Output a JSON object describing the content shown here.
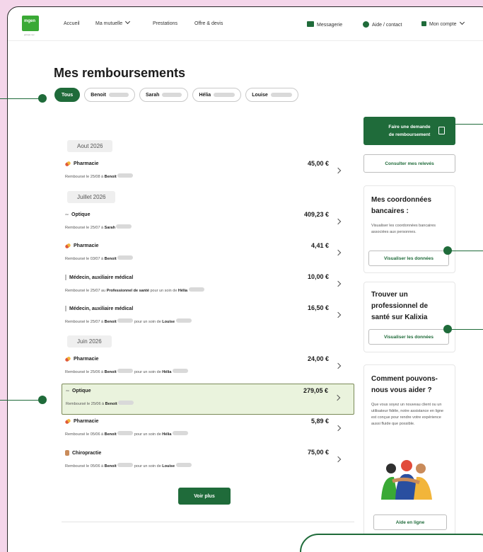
{
  "header": {
    "logo_text": "mgen",
    "logo_sub": "groupe vyv",
    "nav": [
      {
        "label": "Accueil"
      },
      {
        "label": "Ma mutuelle",
        "dropdown": true
      },
      {
        "label": "Prestations"
      },
      {
        "label": "Offre & devis"
      }
    ],
    "messagerie": "Messagerie",
    "aide": "Aide / contact",
    "compte": "Mon compte"
  },
  "page_title": "Mes remboursements",
  "filters": [
    {
      "label": "Tous",
      "active": true
    },
    {
      "label": "Benoit"
    },
    {
      "label": "Sarah"
    },
    {
      "label": "Hélia"
    },
    {
      "label": "Louise"
    }
  ],
  "groups": [
    {
      "month": "Aout 2026",
      "items": [
        {
          "category": "Pharmacie",
          "icon": "pill-icon",
          "amount": "45,00 €",
          "sub_prefix": "Remboursé le 25/08 à ",
          "sub_name": "Benoit",
          "sub_mid": "",
          "sub_name2": ""
        }
      ]
    },
    {
      "month": "Juillet 2026",
      "items": [
        {
          "category": "Optique",
          "icon": "glasses-icon",
          "amount": "409,23 €",
          "sub_prefix": "Remboursé le 25/07 à ",
          "sub_name": "Sarah",
          "sub_mid": "",
          "sub_name2": ""
        },
        {
          "category": "Pharmacie",
          "icon": "pill-icon",
          "amount": "4,41 €",
          "sub_prefix": "Remboursé le 03/07 à ",
          "sub_name": "Benoit",
          "sub_mid": "",
          "sub_name2": ""
        },
        {
          "category": "Médecin, auxiliaire médical",
          "icon": "stethoscope-icon",
          "amount": "10,00 €",
          "sub_prefix": "Remboursé le 25/07 au ",
          "sub_name": "Professionnel de santé",
          "sub_mid": " pour un soin de ",
          "sub_name2": "Hélia"
        },
        {
          "category": "Médecin, auxiliaire médical",
          "icon": "stethoscope-icon",
          "amount": "16,50 €",
          "sub_prefix": "Remboursé le 25/07 à ",
          "sub_name": "Benoit",
          "sub_mid": " pour un soin de ",
          "sub_name2": "Louise"
        }
      ]
    },
    {
      "month": "Juin 2026",
      "items": [
        {
          "category": "Pharmacie",
          "icon": "pill-icon",
          "amount": "24,00 €",
          "sub_prefix": "Remboursé le 25/06 à ",
          "sub_name": "Benoit",
          "sub_mid": " pour un soin de ",
          "sub_name2": "Hélia"
        },
        {
          "category": "Optique",
          "icon": "glasses-icon",
          "amount": "279,05 €",
          "sub_prefix": "Remboursé le 25/06 à ",
          "sub_name": "Benoit",
          "sub_mid": "",
          "sub_name2": "",
          "highlight": true
        },
        {
          "category": "Pharmacie",
          "icon": "pill-icon",
          "amount": "5,89 €",
          "sub_prefix": "Remboursé le 05/06 à ",
          "sub_name": "Benoit",
          "sub_mid": " pour un soin de ",
          "sub_name2": "Hélia"
        },
        {
          "category": "Chiropractie",
          "icon": "spine-icon",
          "amount": "75,00 €",
          "sub_prefix": "Remboursé le 05/06 à ",
          "sub_name": "Benoit",
          "sub_mid": " pour un soin de ",
          "sub_name2": "Louise"
        }
      ]
    }
  ],
  "voir_plus": "Voir plus",
  "sidebar": {
    "demande_line1": "Faire une demande",
    "demande_line2": "de remboursement",
    "releves": "Consulter mes relevés",
    "coord_title": "Mes coordonnées bancaires :",
    "coord_text": "Visualiser les coordonnées bancaires associées aux personnes.",
    "coord_btn": "Visualiser les données",
    "pro_title": "Trouver un professionnel de santé sur Kalixia",
    "pro_btn": "Visualiser les données",
    "help_title": "Comment pouvons-nous vous aider ?",
    "help_text": "Que vous soyez un nouveau client ou un utilisateur fidèle, notre assistance en ligne est conçue pour rendre votre expérience aussi fluide que possible.",
    "help_btn": "Aide en ligne"
  },
  "colors": {
    "accent": "#1f6b3a",
    "background": "#f4d6ea",
    "highlight": "#eaf3dd"
  }
}
